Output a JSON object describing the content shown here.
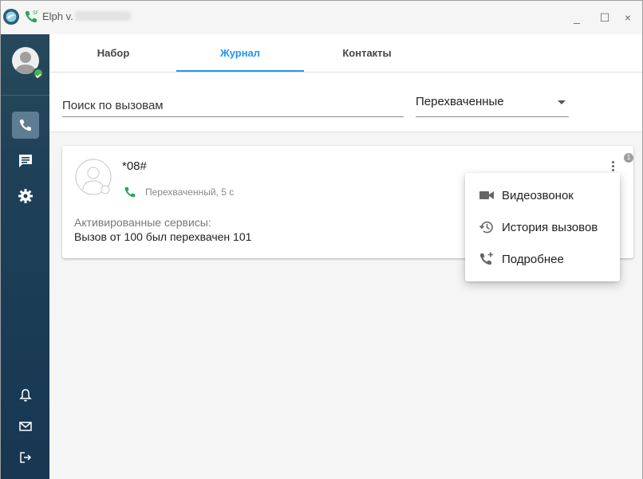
{
  "window": {
    "title": "Elph v.",
    "controls": {
      "minimize": "_",
      "maximize": "☐",
      "close": "×"
    }
  },
  "sidebar": {
    "items": [
      {
        "name": "calls",
        "icon": "phone-icon",
        "active": true
      },
      {
        "name": "messages",
        "icon": "chat-icon",
        "active": false
      },
      {
        "name": "settings",
        "icon": "gear-icon",
        "active": false
      }
    ],
    "bottom": [
      {
        "name": "notifications",
        "icon": "bell-icon"
      },
      {
        "name": "mail",
        "icon": "mail-icon"
      },
      {
        "name": "logout",
        "icon": "logout-icon"
      }
    ]
  },
  "tabs": [
    {
      "label": "Набор",
      "active": false
    },
    {
      "label": "Журнал",
      "active": true
    },
    {
      "label": "Контакты",
      "active": false
    }
  ],
  "search": {
    "placeholder": "Поиск по вызовам",
    "value": ""
  },
  "filter": {
    "selected": "Перехваченные"
  },
  "call_card": {
    "number": "*08#",
    "status": "Перехваченный, 5 с",
    "services_label": "Активированные сервисы:",
    "services_text": "Вызов от 100 был перехвачен 101",
    "badge_count": "1"
  },
  "context_menu": {
    "items": [
      {
        "label": "Видеозвонок",
        "icon": "videocam-icon"
      },
      {
        "label": "История вызовов",
        "icon": "history-icon"
      },
      {
        "label": "Подробнее",
        "icon": "phone-add-icon"
      }
    ]
  },
  "colors": {
    "accent": "#2196f3",
    "call_green": "#26a65b",
    "sidebar_bg": "#1d3f57",
    "online_status": "#4caf50"
  }
}
